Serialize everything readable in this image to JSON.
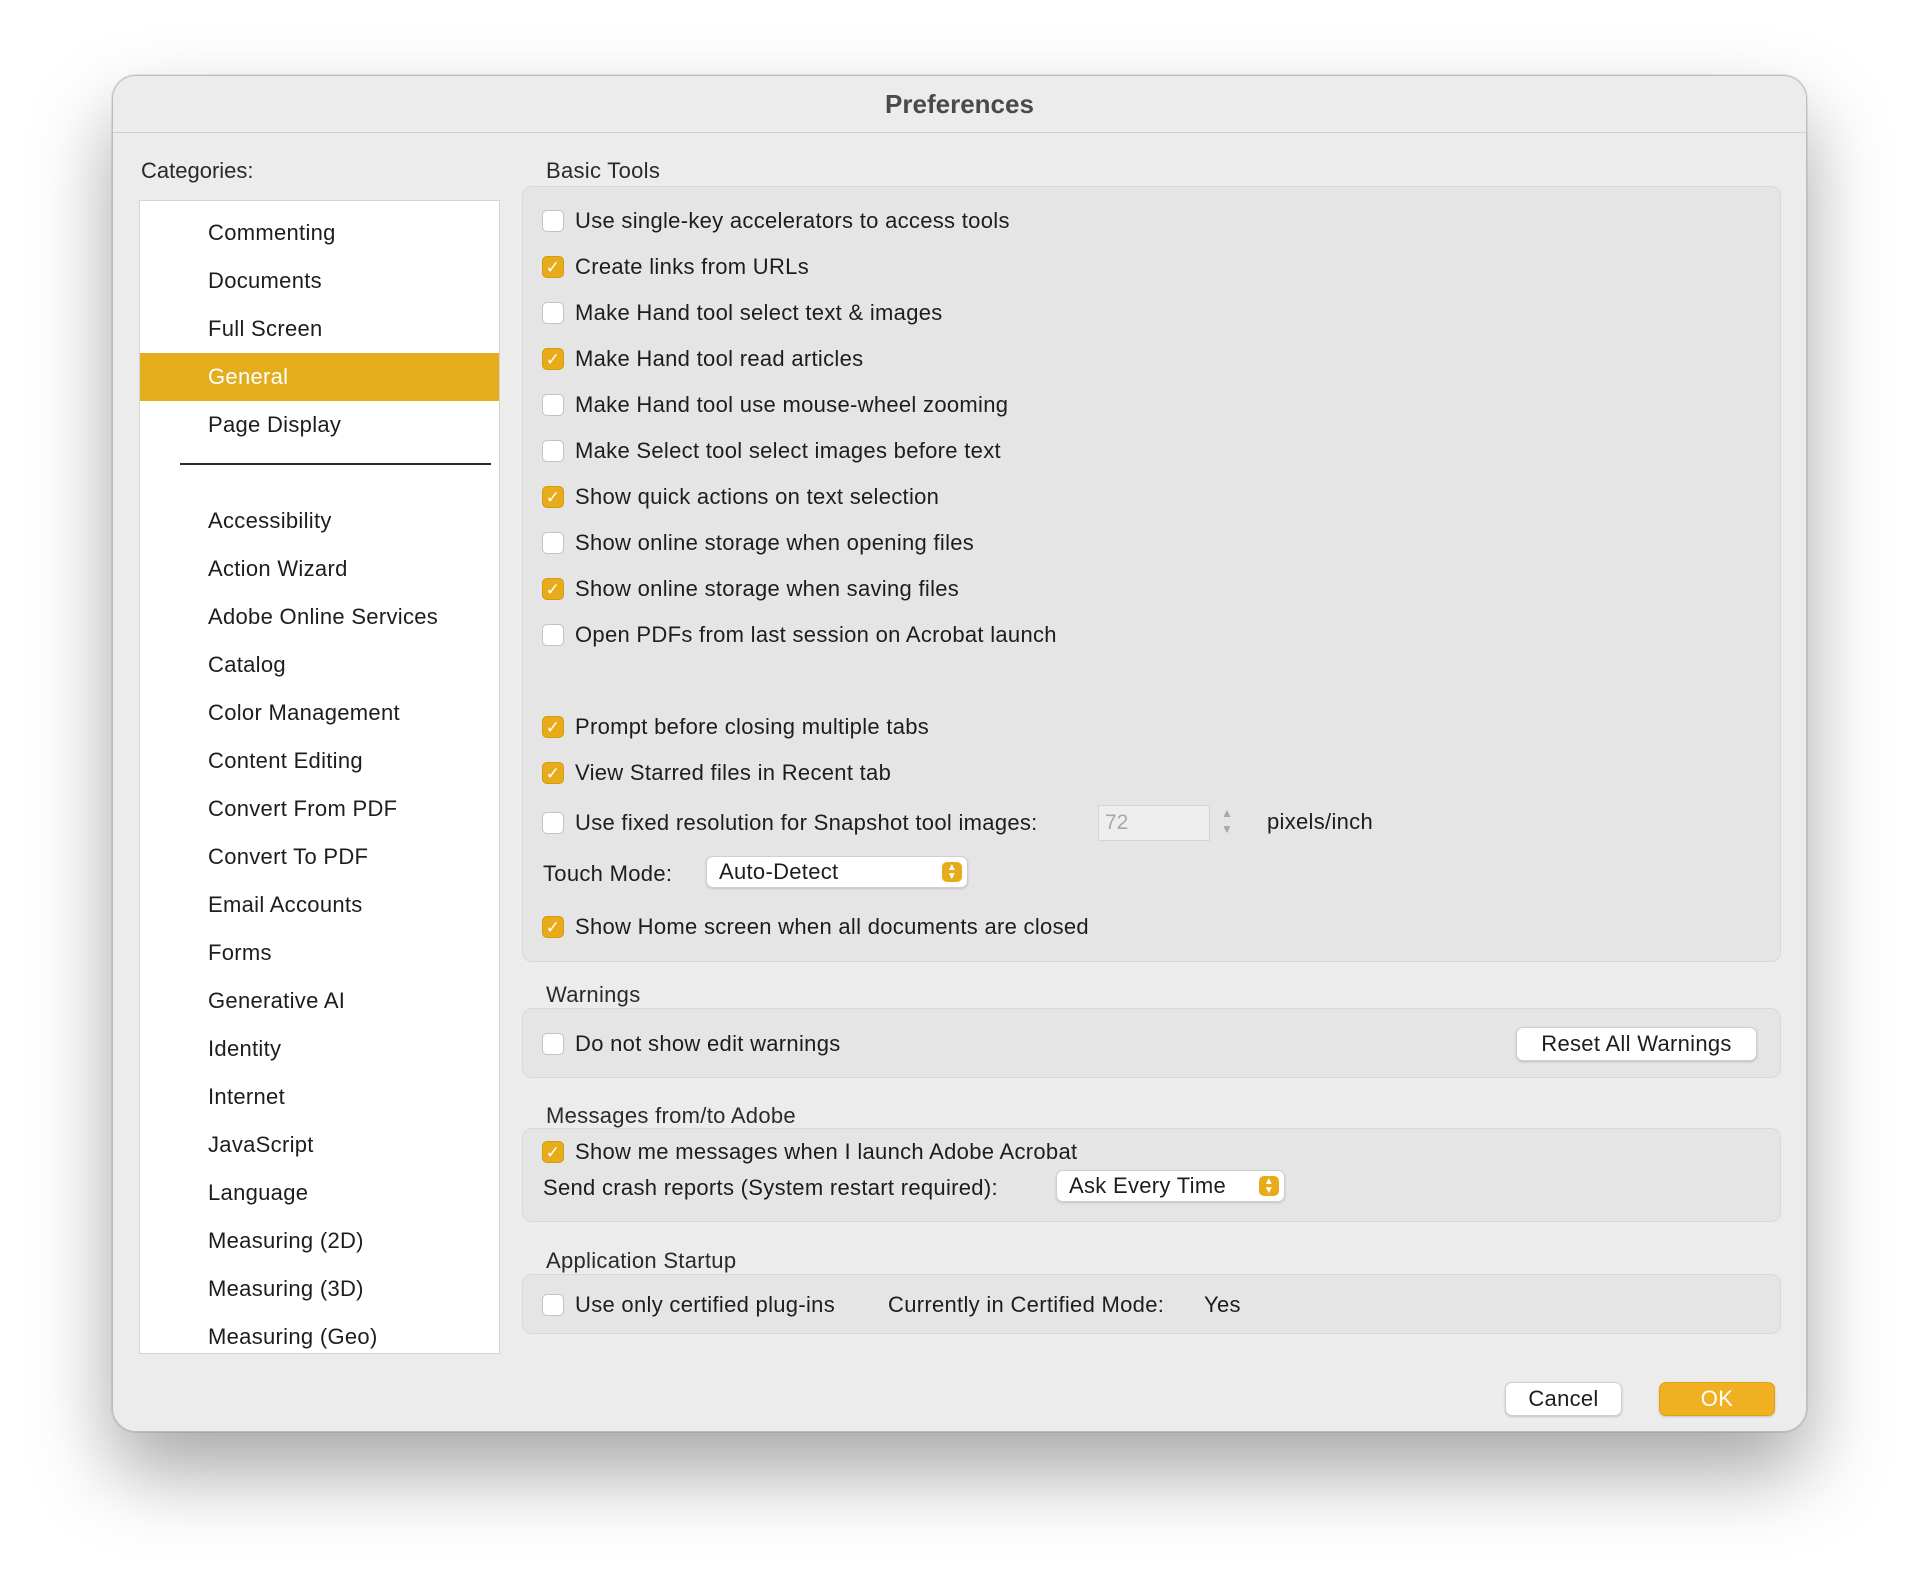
{
  "window": {
    "title": "Preferences"
  },
  "categories": {
    "label": "Categories:",
    "top_items": [
      "Commenting",
      "Documents",
      "Full Screen",
      "General",
      "Page Display"
    ],
    "selected": "General",
    "items": [
      "Accessibility",
      "Action Wizard",
      "Adobe Online Services",
      "Catalog",
      "Color Management",
      "Content Editing",
      "Convert From PDF",
      "Convert To PDF",
      "Email Accounts",
      "Forms",
      "Generative AI",
      "Identity",
      "Internet",
      "JavaScript",
      "Language",
      "Measuring (2D)",
      "Measuring (3D)",
      "Measuring (Geo)"
    ]
  },
  "basic_tools": {
    "title": "Basic Tools",
    "options": [
      {
        "label": "Use single-key accelerators to access tools",
        "checked": false
      },
      {
        "label": "Create links from URLs",
        "checked": true
      },
      {
        "label": "Make Hand tool select text & images",
        "checked": false
      },
      {
        "label": "Make Hand tool read articles",
        "checked": true
      },
      {
        "label": "Make Hand tool use mouse-wheel zooming",
        "checked": false
      },
      {
        "label": "Make Select tool select images before text",
        "checked": false
      },
      {
        "label": "Show quick actions on text selection",
        "checked": true
      },
      {
        "label": "Show online storage when opening files",
        "checked": false
      },
      {
        "label": "Show online storage when saving files",
        "checked": true
      },
      {
        "label": "Open PDFs from last session on Acrobat launch",
        "checked": false
      }
    ],
    "prompt_tabs": {
      "label": "Prompt before closing multiple tabs",
      "checked": true
    },
    "starred": {
      "label": "View Starred files in Recent tab",
      "checked": true
    },
    "snapshot": {
      "label": "Use fixed resolution for Snapshot tool images:",
      "checked": false,
      "value": "72",
      "unit": "pixels/inch"
    },
    "touch_mode": {
      "label": "Touch Mode:",
      "value": "Auto-Detect"
    },
    "home_screen": {
      "label": "Show Home screen when all documents are closed",
      "checked": true
    }
  },
  "warnings": {
    "title": "Warnings",
    "option": {
      "label": "Do not show edit warnings",
      "checked": false
    },
    "reset_button": "Reset All Warnings"
  },
  "messages": {
    "title": "Messages from/to Adobe",
    "option": {
      "label": "Show me messages when I launch Adobe Acrobat",
      "checked": true
    },
    "crash_label": "Send crash reports (System restart required):",
    "crash_value": "Ask Every Time"
  },
  "startup": {
    "title": "Application Startup",
    "option": {
      "label": "Use only certified plug-ins",
      "checked": false
    },
    "mode_label": "Currently in Certified Mode:",
    "mode_value": "Yes"
  },
  "footer": {
    "cancel": "Cancel",
    "ok": "OK"
  },
  "colors": {
    "accent": "#e3ad1c",
    "checkbox": "#e8ab1a",
    "ok_button": "#efb021"
  }
}
